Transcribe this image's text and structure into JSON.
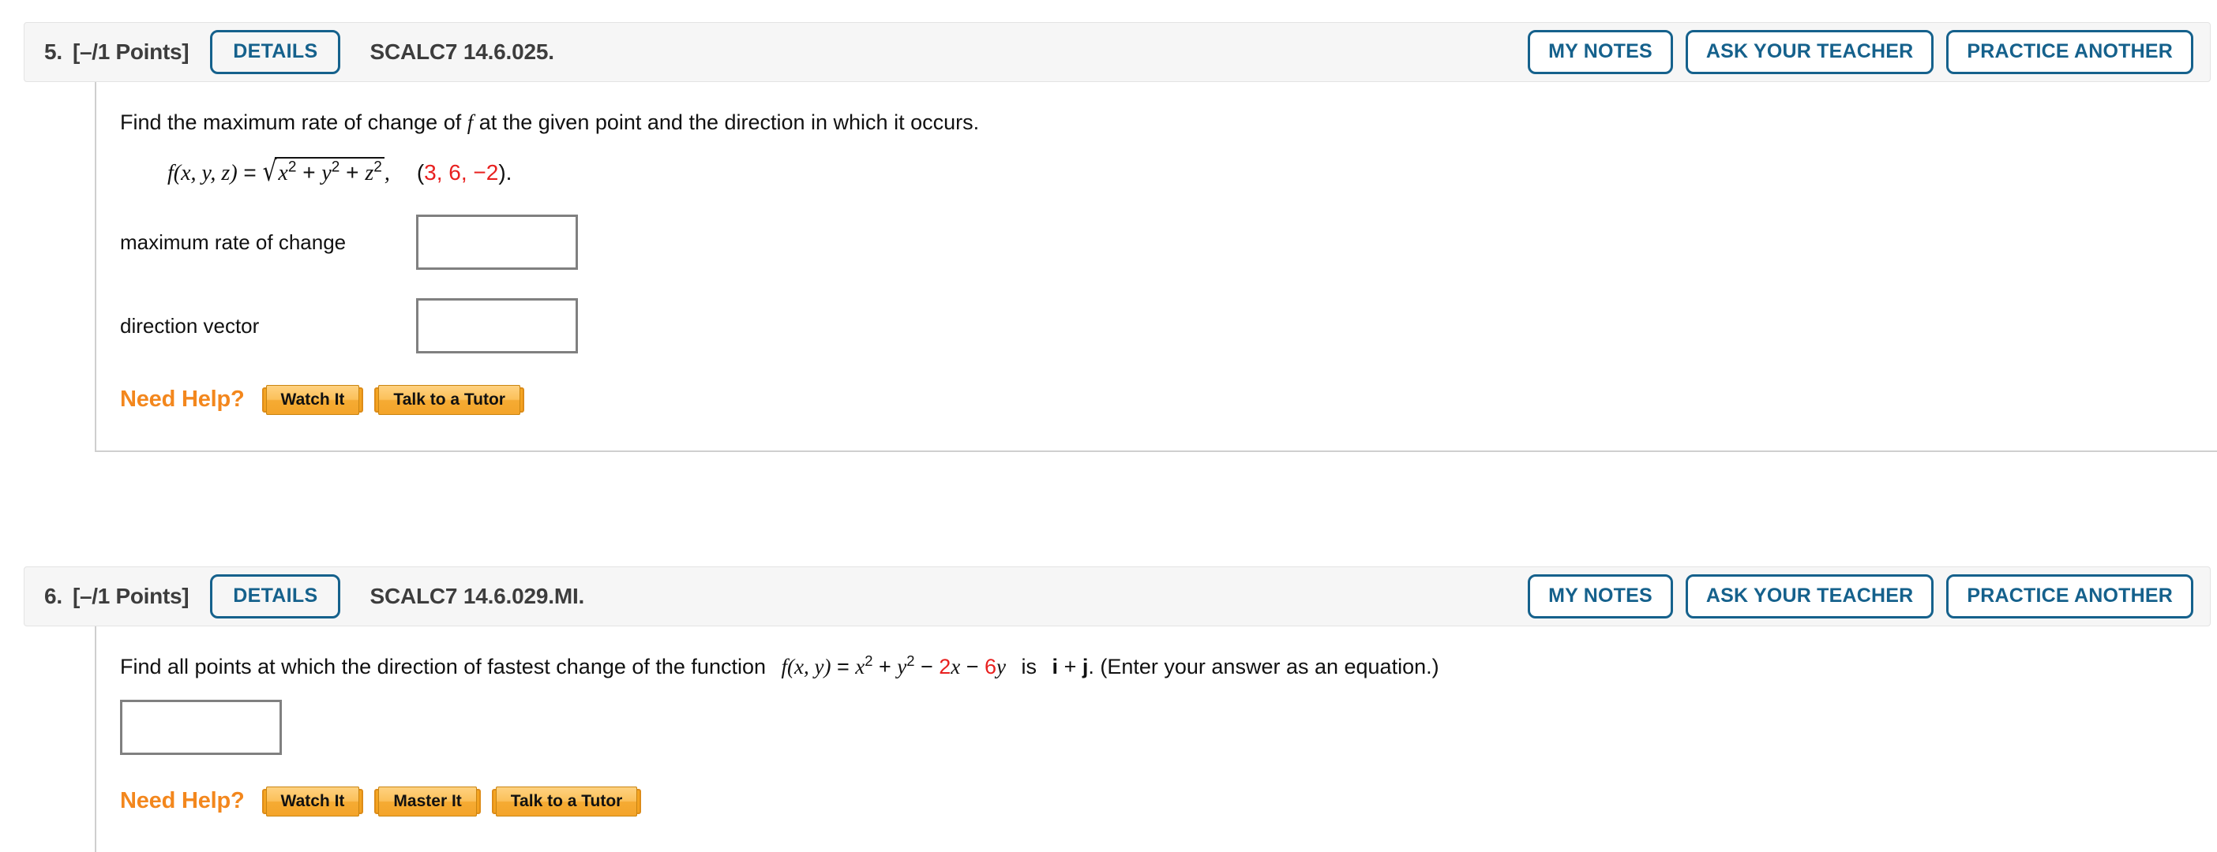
{
  "problems": [
    {
      "number": "5.",
      "points": "[–/1 Points]",
      "details_label": "DETAILS",
      "code": "SCALC7 14.6.025.",
      "header_buttons": [
        "MY NOTES",
        "ASK YOUR TEACHER",
        "PRACTICE ANOTHER"
      ],
      "prompt_a": "Find the maximum rate of change of ",
      "prompt_f": "f",
      "prompt_b": " at the given point and the direction in which it occurs.",
      "math": {
        "fn": "f",
        "args": "(x, y, z)",
        "equals": " = ",
        "radicand_x": "x",
        "radicand_x_sup": "2",
        "plus1": " + ",
        "radicand_y": "y",
        "radicand_y_sup": "2",
        "plus2": " + ",
        "radicand_z": "z",
        "radicand_z_sup": "2",
        "comma": ",",
        "point_open": "(",
        "point_1": "3",
        "point_sep1": ", ",
        "point_2": "6",
        "point_sep2": ", ",
        "point_3": "−2",
        "point_close": ")."
      },
      "answers": [
        {
          "label": "maximum rate of change",
          "value": "",
          "placeholder": ""
        },
        {
          "label": "direction vector",
          "value": "",
          "placeholder": ""
        }
      ],
      "help_label": "Need Help?",
      "help_buttons": [
        "Watch It",
        "Talk to a Tutor"
      ]
    },
    {
      "number": "6.",
      "points": "[–/1 Points]",
      "details_label": "DETAILS",
      "code": "SCALC7 14.6.029.MI.",
      "header_buttons": [
        "MY NOTES",
        "ASK YOUR TEACHER",
        "PRACTICE ANOTHER"
      ],
      "prompt_a": "Find all points at which the direction of fastest change of the function ",
      "math": {
        "fn": "f",
        "args": "(x, y)",
        "equals": " = ",
        "t1": "x",
        "t1_sup": "2",
        "plus1": " + ",
        "t2": "y",
        "t2_sup": "2",
        "minus1": " − ",
        "c1": "2",
        "t3": "x",
        "minus2": " − ",
        "c2": "6",
        "t4": "y"
      },
      "prompt_is": " is ",
      "vector_i": "i",
      "vector_plus": " + ",
      "vector_j": "j",
      "prompt_b": ". (Enter your answer as an equation.)",
      "answer": {
        "value": "",
        "placeholder": ""
      },
      "help_label": "Need Help?",
      "help_buttons": [
        "Watch It",
        "Master It",
        "Talk to a Tutor"
      ]
    }
  ],
  "colors": {
    "accent_blue": "#15618c",
    "help_orange": "#f3871d",
    "math_red": "#e8201f",
    "header_bg": "#f6f6f6",
    "border_gray": "#cfcfcf"
  }
}
